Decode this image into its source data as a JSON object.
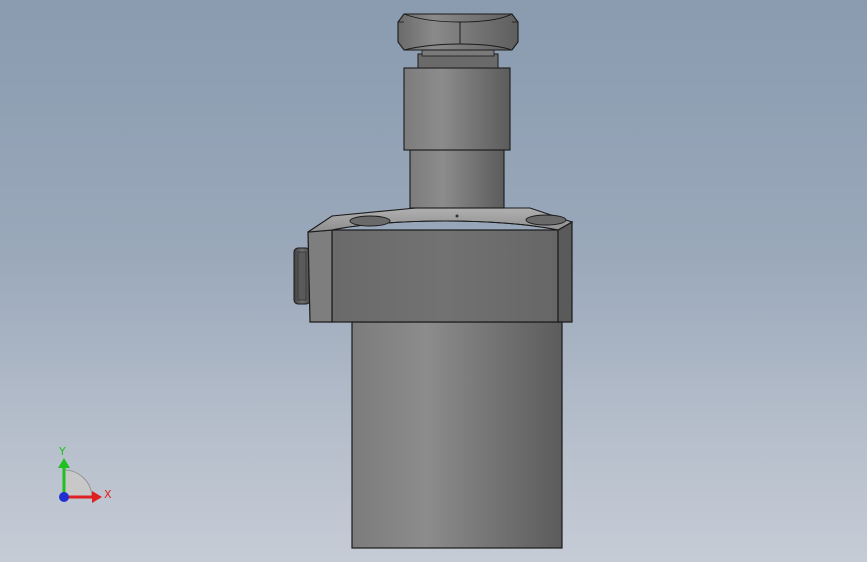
{
  "triad": {
    "x_label": "X",
    "y_label": "Y",
    "x_color": "#e02020",
    "y_color": "#20c020",
    "z_color": "#2030d0"
  },
  "colors": {
    "background_top": "#8a9bb0",
    "background_bottom": "#c6ccd6",
    "body_light": "#8a8a8a",
    "body_dark": "#5a5a5a",
    "edge": "#1a1a1a"
  }
}
